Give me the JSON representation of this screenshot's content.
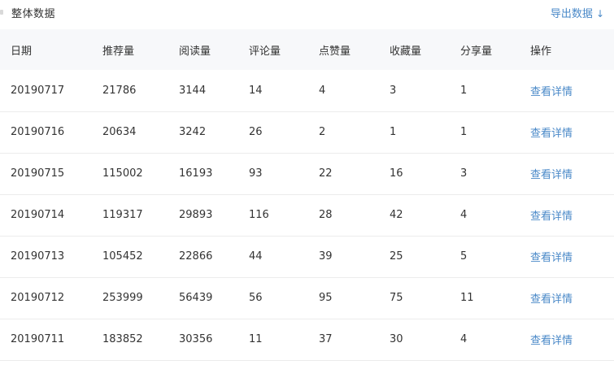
{
  "header": {
    "title": "整体数据",
    "export_label": "导出数据",
    "export_icon": "↓"
  },
  "table": {
    "columns": [
      "日期",
      "推荐量",
      "阅读量",
      "评论量",
      "点赞量",
      "收藏量",
      "分享量",
      "操作"
    ],
    "rows": [
      [
        "20190717",
        "21786",
        "3144",
        "14",
        "4",
        "3",
        "1",
        "查看详情"
      ],
      [
        "20190716",
        "20634",
        "3242",
        "26",
        "2",
        "1",
        "1",
        "查看详情"
      ],
      [
        "20190715",
        "115002",
        "16193",
        "93",
        "22",
        "16",
        "3",
        "查看详情"
      ],
      [
        "20190714",
        "119317",
        "29893",
        "116",
        "28",
        "42",
        "4",
        "查看详情"
      ],
      [
        "20190713",
        "105452",
        "22866",
        "44",
        "39",
        "25",
        "5",
        "查看详情"
      ],
      [
        "20190712",
        "253999",
        "56439",
        "56",
        "95",
        "75",
        "11",
        "查看详情"
      ],
      [
        "20190711",
        "183852",
        "30356",
        "11",
        "37",
        "30",
        "4",
        "查看详情"
      ]
    ]
  },
  "colors": {
    "link": "#4a89c8",
    "header_bg": "#f7f8fa",
    "text": "#333333"
  }
}
